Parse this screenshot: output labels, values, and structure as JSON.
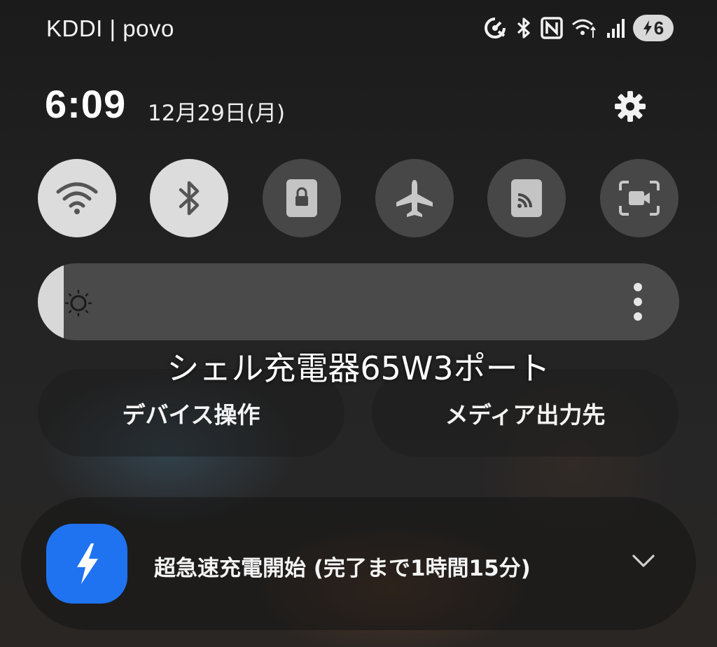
{
  "status_bar": {
    "carrier": "KDDI | povo",
    "icons": [
      "data-saver-icon",
      "bluetooth-icon",
      "nfc-icon",
      "wifi-data-icon",
      "signal-icon"
    ],
    "battery_level": "6"
  },
  "header": {
    "time": "6:09",
    "date": "12月29日(月)",
    "settings_icon": "gear-icon"
  },
  "quick_toggles": [
    {
      "name": "wifi",
      "icon": "wifi-icon",
      "state": "on"
    },
    {
      "name": "bluetooth",
      "icon": "bluetooth-icon",
      "state": "on"
    },
    {
      "name": "secure-folder",
      "icon": "lock-folder-icon",
      "state": "off"
    },
    {
      "name": "airplane-mode",
      "icon": "airplane-icon",
      "state": "off"
    },
    {
      "name": "smart-view",
      "icon": "cast-icon",
      "state": "off"
    },
    {
      "name": "screen-recorder",
      "icon": "screen-record-icon",
      "state": "off"
    }
  ],
  "brightness": {
    "level": 0.04
  },
  "media_title": "シェル充電器65W3ポート",
  "actions": {
    "device_control": "デバイス操作",
    "media_output": "メディア出力先"
  },
  "notification": {
    "app_icon": "lightning-icon",
    "text": "超急速充電開始 (完了まで1時間15分)",
    "expand_icon": "chevron-down-icon"
  },
  "colors": {
    "toggle_on": "#dcdcdc",
    "toggle_off": "#474747",
    "notification_icon_bg": "#1f73f0"
  }
}
